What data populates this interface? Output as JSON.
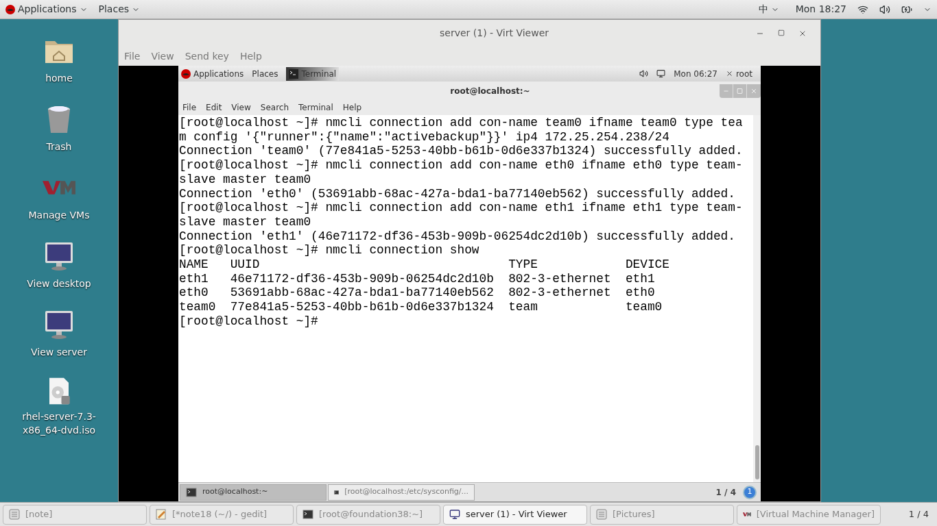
{
  "top_bar": {
    "applications": "Applications",
    "places": "Places",
    "input_method": "中",
    "clock": "Mon 18:27"
  },
  "desktop_icons": [
    {
      "kind": "home",
      "label": "home"
    },
    {
      "kind": "trash",
      "label": "Trash"
    },
    {
      "kind": "vm",
      "label": "Manage VMs"
    },
    {
      "kind": "monitor",
      "label": "View desktop"
    },
    {
      "kind": "monitor",
      "label": "View server"
    },
    {
      "kind": "disc",
      "label": "rhel-server-7.3-x86_64-dvd.iso"
    }
  ],
  "viewer_window": {
    "title": "server (1) - Virt Viewer",
    "menu": [
      "File",
      "View",
      "Send key",
      "Help"
    ]
  },
  "guest": {
    "top_bar": {
      "applications": "Applications",
      "places": "Places",
      "task": "Terminal",
      "clock": "Mon 06:27",
      "user": "root"
    },
    "terminal": {
      "title": "root@localhost:~",
      "menu": [
        "File",
        "Edit",
        "View",
        "Search",
        "Terminal",
        "Help"
      ],
      "lines": [
        "[root@localhost ~]# nmcli connection add con-name team0 ifname team0 type tea",
        "m config '{\"runner\":{\"name\":\"activebackup\"}}' ip4 172.25.254.238/24",
        "Connection 'team0' (77e841a5-5253-40bb-b61b-0d6e337b1324) successfully added.",
        "[root@localhost ~]# nmcli connection add con-name eth0 ifname eth0 type team-",
        "slave master team0",
        "Connection 'eth0' (53691abb-68ac-427a-bda1-ba77140eb562) successfully added.",
        "[root@localhost ~]# nmcli connection add con-name eth1 ifname eth1 type team-",
        "slave master team0",
        "Connection 'eth1' (46e71172-df36-453b-909b-06254dc2d10b) successfully added.",
        "[root@localhost ~]# nmcli connection show",
        "NAME   UUID                                  TYPE            DEVICE",
        "eth1   46e71172-df36-453b-909b-06254dc2d10b  802-3-ethernet  eth1",
        "eth0   53691abb-68ac-427a-bda1-ba77140eb562  802-3-ethernet  eth0",
        "team0  77e841a5-5253-40bb-b61b-0d6e337b1324  team            team0",
        "[root@localhost ~]#"
      ]
    },
    "taskbar": {
      "items": [
        {
          "label": "root@localhost:~",
          "selected": true
        },
        {
          "label": "[root@localhost:/etc/sysconfig/...",
          "selected": false
        }
      ],
      "pager": "1 / 4",
      "badge": "1"
    }
  },
  "taskbar": {
    "items": [
      {
        "kind": "note",
        "label": "[note]",
        "selected": false
      },
      {
        "kind": "editor",
        "label": "[*note18 (~/) - gedit]",
        "selected": false
      },
      {
        "kind": "terminal",
        "label": "[root@foundation38:~]",
        "selected": false
      },
      {
        "kind": "monitor",
        "label": "server (1) - Virt Viewer",
        "selected": true
      },
      {
        "kind": "note",
        "label": "[Pictures]",
        "selected": false
      },
      {
        "kind": "vm",
        "label": "[Virtual Machine Manager]",
        "selected": false
      }
    ],
    "pager": "1 / 4"
  }
}
